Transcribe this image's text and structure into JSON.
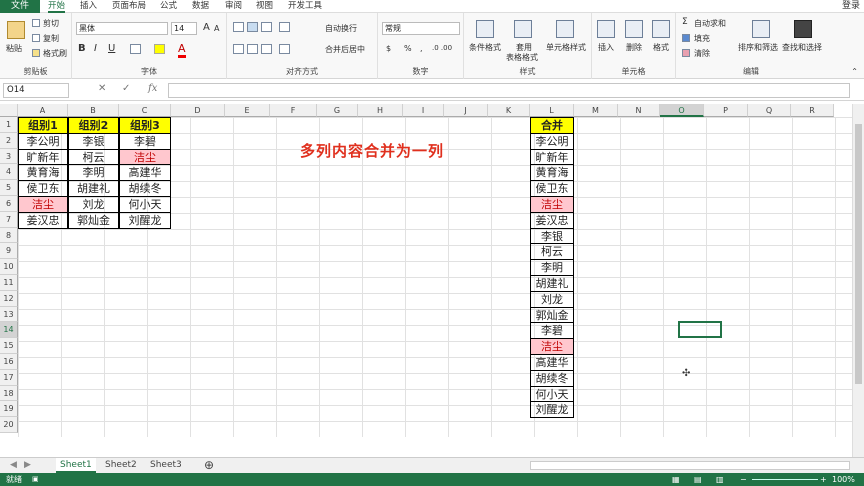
{
  "menu": {
    "file": "文件",
    "tabs": [
      "开始",
      "插入",
      "页面布局",
      "公式",
      "数据",
      "审阅",
      "视图",
      "开发工具"
    ],
    "login": "登录"
  },
  "ribbon": {
    "clipboard": {
      "paste": "粘贴",
      "cut": "剪切",
      "copy": "复制",
      "format_painter": "格式刷",
      "label": "剪贴板"
    },
    "font": {
      "name": "黑体",
      "size": "14",
      "bold": "B",
      "italic": "I",
      "underline": "U",
      "label": "字体"
    },
    "alignment": {
      "wrap": "自动换行",
      "merge": "合并后居中",
      "label": "对齐方式"
    },
    "number": {
      "format": "常规",
      "label": "数字"
    },
    "styles": {
      "conditional": "条件格式",
      "table1": "套用",
      "table2": "表格格式",
      "cell_styles": "单元格样式",
      "label": "样式"
    },
    "cells": {
      "insert": "插入",
      "delete": "删除",
      "format": "格式",
      "label": "单元格"
    },
    "editing": {
      "autosum": "自动求和",
      "fill": "填充",
      "clear": "清除",
      "sort": "排序和筛选",
      "find": "查找和选择",
      "label": "编辑"
    }
  },
  "formula_bar": {
    "name_box": "O14",
    "fx": "fx",
    "value": ""
  },
  "columns": [
    "A",
    "B",
    "C",
    "D",
    "E",
    "F",
    "G",
    "H",
    "I",
    "J",
    "K",
    "L",
    "M",
    "N",
    "O",
    "P",
    "Q",
    "R"
  ],
  "rows": [
    "1",
    "2",
    "3",
    "4",
    "5",
    "6",
    "7",
    "8",
    "9",
    "10",
    "11",
    "12",
    "13",
    "14",
    "15",
    "16",
    "17",
    "18",
    "19",
    "20"
  ],
  "selected_cell": "O14",
  "headers": [
    "组别1",
    "组别2",
    "组别3"
  ],
  "table": [
    [
      "李公明",
      "李银",
      "李碧"
    ],
    [
      "旷新年",
      "柯云",
      "洁尘"
    ],
    [
      "黄育海",
      "李明",
      "高建华"
    ],
    [
      "侯卫东",
      "胡建礼",
      "胡续冬"
    ],
    [
      "洁尘",
      "刘龙",
      "何小天"
    ],
    [
      "姜汉忠",
      "郭灿金",
      "刘醒龙"
    ]
  ],
  "title": "多列内容合并为一列",
  "merged_header": "合并",
  "merged": [
    "李公明",
    "旷新年",
    "黄育海",
    "侯卫东",
    "洁尘",
    "姜汉忠",
    "李银",
    "柯云",
    "李明",
    "胡建礼",
    "刘龙",
    "郭灿金",
    "李碧",
    "洁尘",
    "高建华",
    "胡续冬",
    "何小天",
    "刘醒龙"
  ],
  "highlight_color": "#ffc7ce",
  "header_color": "#ffff00",
  "sheets": [
    "Sheet1",
    "Sheet2",
    "Sheet3"
  ],
  "status": {
    "ready": "就绪",
    "zoom": "100%"
  }
}
